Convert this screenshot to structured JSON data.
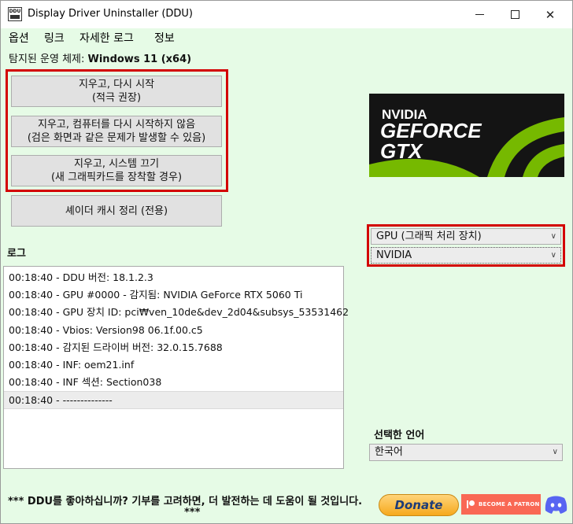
{
  "window": {
    "title": "Display Driver Uninstaller (DDU)",
    "icon_text": "DDU",
    "controls": {
      "minimize": "minimize-icon",
      "maximize": "maximize-icon",
      "close": "✕"
    }
  },
  "menu": [
    {
      "label": "옵션"
    },
    {
      "label": "링크"
    },
    {
      "label": "자세한 로그"
    },
    {
      "label": "정보"
    }
  ],
  "os": {
    "label": "탐지된 운영 체제:",
    "value": "Windows 11 (x64)"
  },
  "buttons": {
    "clean_restart": {
      "line1": "지우고, 다시 시작",
      "line2": "(적극 권장)"
    },
    "clean_no_restart": {
      "line1": "지우고, 컴퓨터를 다시 시작하지 않음",
      "line2": "(검은 화면과 같은 문제가 발생할 수 있음)"
    },
    "clean_shutdown": {
      "line1": "지우고, 시스템 끄기",
      "line2": "(새 그래픽카드를 장착할 경우)"
    },
    "shader_cache": {
      "line1": "셰이더 캐시 정리 (전용)"
    }
  },
  "log": {
    "label": "로그",
    "entries": [
      "00:18:40 - DDU 버전: 18.1.2.3",
      "00:18:40 - GPU #0000 - 감지됨: NVIDIA GeForce RTX 5060 Ti",
      "00:18:40 - GPU 장치 ID: pci₩ven_10de&dev_2d04&subsys_53531462",
      "00:18:40 - Vbios: Version98 06.1f.00.c5",
      "00:18:40 - 감지된 드라이버 버전: 32.0.15.7688",
      "00:18:40 - INF: oem21.inf",
      "00:18:40 - INF 섹션: Section038",
      "00:18:40 - --------------"
    ]
  },
  "logo": {
    "brand": "NVIDIA",
    "line1": "GEFORCE",
    "line2": "GTX",
    "accent": "#76b900"
  },
  "device": {
    "type_selected": "GPU (그래픽 처리 장치)",
    "vendor_selected": "NVIDIA"
  },
  "language": {
    "label": "선택한 언어",
    "selected": "한국어"
  },
  "footer": {
    "message": "*** DDU를 좋아하십니까? 기부를 고려하면, 더 발전하는 데 도움이 될 것입니다.",
    "stars": "***",
    "donate_label": "Donate",
    "patron_label": "BECOME A PATRON"
  },
  "colors": {
    "background": "#e6fbe6",
    "highlight_border": "#d30000",
    "button_face": "#e1e1e1"
  }
}
